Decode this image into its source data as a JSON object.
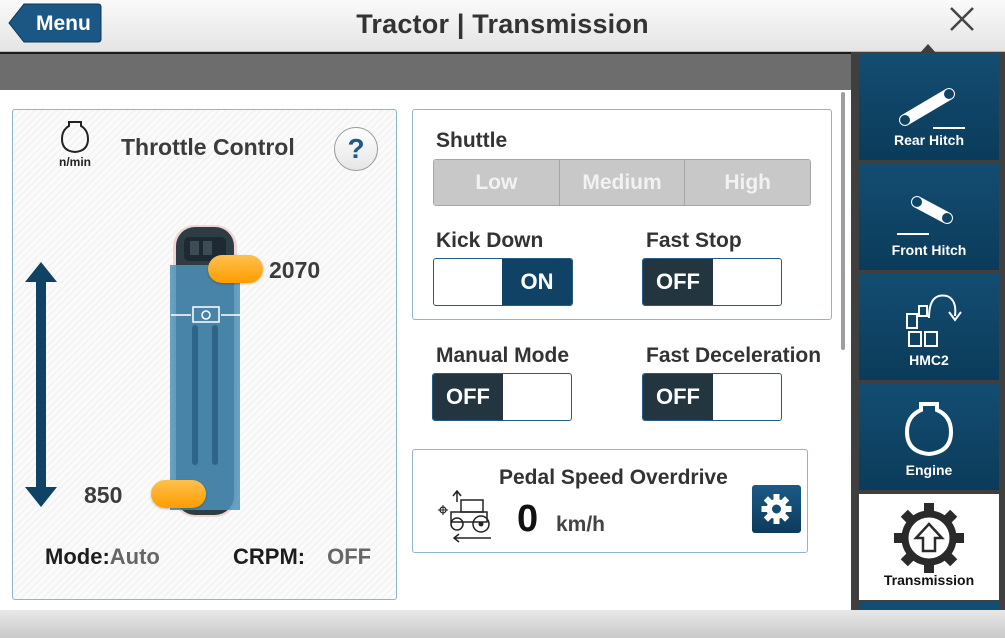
{
  "header": {
    "menu_label": "Menu",
    "title": "Tractor | Transmission"
  },
  "throttle": {
    "title": "Throttle Control",
    "unit_label": "n/min",
    "help_label": "?",
    "upper_value": "2070",
    "lower_value": "850",
    "mode_label": "Mode:",
    "mode_value": "Auto",
    "crpm_label": "CRPM:",
    "crpm_value": "OFF"
  },
  "shuttle": {
    "label": "Shuttle",
    "options": [
      "Low",
      "Medium",
      "High"
    ]
  },
  "kick_down": {
    "label": "Kick Down",
    "state": "ON"
  },
  "fast_stop": {
    "label": "Fast Stop",
    "state": "OFF"
  },
  "manual_mode": {
    "label": "Manual Mode",
    "state": "OFF"
  },
  "fast_deceleration": {
    "label": "Fast Deceleration",
    "state": "OFF"
  },
  "pedal_speed_overdrive": {
    "title": "Pedal Speed Overdrive",
    "value": "0",
    "unit": "km/h"
  },
  "sidebar": {
    "items": [
      {
        "label": "Rear Hitch",
        "icon": "rear-hitch-icon"
      },
      {
        "label": "Front Hitch",
        "icon": "front-hitch-icon"
      },
      {
        "label": "HMC2",
        "icon": "hmc2-icon"
      },
      {
        "label": "Engine",
        "icon": "engine-icon"
      },
      {
        "label": "Transmission",
        "icon": "transmission-icon",
        "active": true
      }
    ]
  },
  "colors": {
    "accent_dark_blue": "#0f4265",
    "handle_orange": "#ff9d00",
    "panel_border": "#8fb5cc"
  }
}
